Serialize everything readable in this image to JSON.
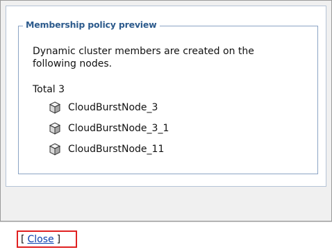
{
  "dialog": {
    "legend": "Membership policy preview",
    "description": "Dynamic cluster members are created on the following nodes.",
    "total_label": "Total 3",
    "nodes": [
      {
        "name": "CloudBurstNode_3",
        "icon": "node-cube-icon"
      },
      {
        "name": "CloudBurstNode_3_1",
        "icon": "node-cube-icon"
      },
      {
        "name": "CloudBurstNode_11",
        "icon": "node-cube-icon"
      }
    ]
  },
  "footer": {
    "open_bracket": "[",
    "close_label": "Close",
    "close_bracket": "]",
    "highlight_color": "#e02020"
  }
}
